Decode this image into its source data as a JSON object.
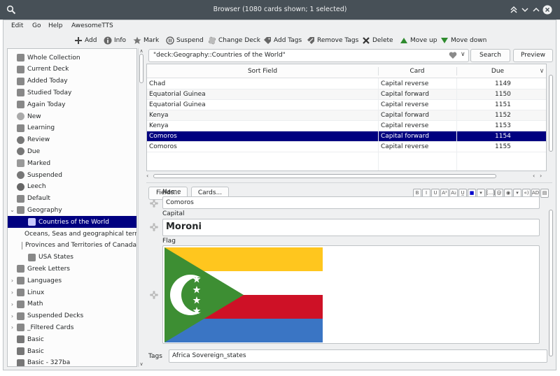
{
  "window": {
    "title": "Browser (1080 cards shown; 1 selected)"
  },
  "menu": [
    "Edit",
    "Go",
    "Help",
    "AwesomeTTS"
  ],
  "toolbar": [
    {
      "label": "Add",
      "icon": "add-icon"
    },
    {
      "label": "Info",
      "icon": "info-icon"
    },
    {
      "label": "Mark",
      "icon": "star-icon"
    },
    {
      "label": "Suspend",
      "icon": "suspend-icon"
    },
    {
      "label": "Change Deck",
      "icon": "deck-icon"
    },
    {
      "label": "Add Tags",
      "icon": "tag-add-icon"
    },
    {
      "label": "Remove Tags",
      "icon": "tag-remove-icon"
    },
    {
      "label": "Delete",
      "icon": "delete-icon"
    },
    {
      "label": "Move up",
      "icon": "arrow-up-icon"
    },
    {
      "label": "Move down",
      "icon": "arrow-down-icon"
    }
  ],
  "sidebar": {
    "items": [
      {
        "label": "Whole Collection",
        "icon": "collection-icon",
        "expander": "",
        "indent": 0
      },
      {
        "label": "Current Deck",
        "icon": "deck-icon",
        "expander": "",
        "indent": 0
      },
      {
        "label": "Added Today",
        "icon": "calendar-icon",
        "expander": "",
        "indent": 0
      },
      {
        "label": "Studied Today",
        "icon": "calendar-icon",
        "expander": "",
        "indent": 0
      },
      {
        "label": "Again Today",
        "icon": "calendar-icon",
        "expander": "",
        "indent": 0
      },
      {
        "label": "New",
        "icon": "new-icon",
        "expander": "",
        "indent": 0
      },
      {
        "label": "Learning",
        "icon": "learning-icon",
        "expander": "",
        "indent": 0
      },
      {
        "label": "Review",
        "icon": "review-icon",
        "expander": "",
        "indent": 0
      },
      {
        "label": "Due",
        "icon": "clock-icon",
        "expander": "",
        "indent": 0
      },
      {
        "label": "Marked",
        "icon": "star-icon",
        "expander": "",
        "indent": 0
      },
      {
        "label": "Suspended",
        "icon": "suspend-icon",
        "expander": "",
        "indent": 0
      },
      {
        "label": "Leech",
        "icon": "leech-icon",
        "expander": "",
        "indent": 0
      },
      {
        "label": "Default",
        "icon": "deck-icon",
        "expander": "",
        "indent": 0
      },
      {
        "label": "Geography",
        "icon": "deck-icon",
        "expander": "v",
        "indent": 0
      },
      {
        "label": "Countries of the World",
        "icon": "deck-icon",
        "expander": "",
        "indent": 1,
        "selected": true
      },
      {
        "label": "Oceans, Seas and geographical terri...",
        "icon": "deck-icon",
        "expander": "",
        "indent": 1
      },
      {
        "label": "Provinces and Territories of Canada",
        "icon": "deck-icon",
        "expander": "",
        "indent": 1
      },
      {
        "label": "USA States",
        "icon": "deck-icon",
        "expander": "",
        "indent": 1
      },
      {
        "label": "Greek Letters",
        "icon": "deck-icon",
        "expander": "",
        "indent": 0
      },
      {
        "label": "Languages",
        "icon": "deck-icon",
        "expander": ">",
        "indent": 0
      },
      {
        "label": "Linux",
        "icon": "deck-icon",
        "expander": ">",
        "indent": 0
      },
      {
        "label": "Math",
        "icon": "deck-icon",
        "expander": ">",
        "indent": 0
      },
      {
        "label": "Suspended Decks",
        "icon": "deck-icon",
        "expander": ">",
        "indent": 0
      },
      {
        "label": "_Filtered Cards",
        "icon": "deck-icon",
        "expander": ">",
        "indent": 0
      },
      {
        "label": "Basic",
        "icon": "note-type-icon",
        "expander": "",
        "indent": 0
      },
      {
        "label": "Basic",
        "icon": "note-type-icon",
        "expander": "",
        "indent": 0
      },
      {
        "label": "Basic - 327ba",
        "icon": "note-type-icon",
        "expander": "",
        "indent": 0
      }
    ]
  },
  "search": {
    "value": "\"deck:Geography::Countries of the World\"",
    "search_label": "Search",
    "preview_label": "Preview"
  },
  "table": {
    "columns": [
      "Sort Field",
      "Card",
      "Due"
    ],
    "rows": [
      {
        "sort_field": "Chad",
        "card": "Capital reverse",
        "due": "1149"
      },
      {
        "sort_field": "Equatorial Guinea",
        "card": "Capital forward",
        "due": "1150"
      },
      {
        "sort_field": "Equatorial Guinea",
        "card": "Capital reverse",
        "due": "1151"
      },
      {
        "sort_field": "Kenya",
        "card": "Capital forward",
        "due": "1152"
      },
      {
        "sort_field": "Kenya",
        "card": "Capital reverse",
        "due": "1153"
      },
      {
        "sort_field": "Comoros",
        "card": "Capital forward",
        "due": "1154",
        "selected": true
      },
      {
        "sort_field": "Comoros",
        "card": "Capital reverse",
        "due": "1155"
      }
    ]
  },
  "editor": {
    "fields_button": "Fields...",
    "cards_button": "Cards...",
    "format_buttons": [
      "B",
      "I",
      "U",
      "A²",
      "A₂",
      "U̲",
      "■",
      "▾",
      "[...]",
      "@",
      "◉",
      "▾",
      "«)",
      "AD",
      "▤"
    ],
    "fields": [
      {
        "name": "Name",
        "value": "Comoros"
      },
      {
        "name": "Capital",
        "value": "Moroni"
      },
      {
        "name": "Flag",
        "value": ""
      }
    ],
    "tags_label": "Tags",
    "tags_value": "Africa Sovereign_states",
    "flag_colors": {
      "yellow": "#ffc61e",
      "white": "#ffffff",
      "red": "#ce1126",
      "blue": "#3a75c4",
      "green": "#3d8e33"
    }
  },
  "colors": {
    "titlebar": "#475057",
    "selection": "#000080"
  }
}
